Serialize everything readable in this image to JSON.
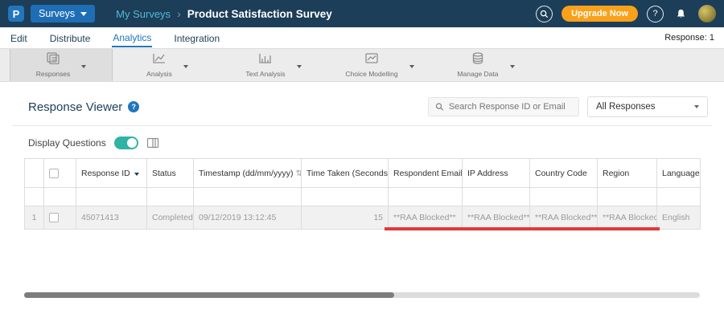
{
  "colors": {
    "navbar_bg": "#1c3e58",
    "brand_blue": "#2176bd",
    "breadcrumb_link": "#56b7d5",
    "upgrade_orange": "#f9a11b",
    "tab_active_blue": "#2176bd",
    "toggle_teal": "#2fb3a6",
    "link_blue": "#337ab7",
    "annotation_red": "#e03a3a"
  },
  "topbar": {
    "logo_letter": "P",
    "product_menu_label": "Surveys",
    "breadcrumb": {
      "parent": "My Surveys",
      "separator": "›",
      "current": "Product Satisfaction Survey"
    },
    "upgrade_label": "Upgrade Now",
    "help_glyph": "?"
  },
  "tabs": {
    "items": [
      {
        "label": "Edit"
      },
      {
        "label": "Distribute"
      },
      {
        "label": "Analytics"
      },
      {
        "label": "Integration"
      }
    ],
    "response_count": "Response: 1"
  },
  "toolbar": {
    "items": [
      {
        "label": "Responses"
      },
      {
        "label": "Analysis"
      },
      {
        "label": "Text Analysis"
      },
      {
        "label": "Choice Modelling"
      },
      {
        "label": "Manage Data"
      }
    ]
  },
  "viewer": {
    "title": "Response Viewer",
    "help_glyph": "?",
    "search_placeholder": "Search Response ID or Email",
    "filter_dropdown_value": "All Responses",
    "display_questions_label": "Display Questions"
  },
  "table": {
    "sort_glyph": "⇅",
    "columns": {
      "response_id": "Response ID",
      "status": "Status",
      "timestamp": "Timestamp (dd/mm/yyyy)",
      "time_taken": "Time Taken (Seconds)",
      "respondent_email": "Respondent Email",
      "ip_address": "IP Address",
      "country_code": "Country Code",
      "region": "Region",
      "language": "Language"
    },
    "rows": [
      {
        "index": "1",
        "response_id": "45071413",
        "status": "Completed",
        "timestamp": "09/12/2019 13:12:45",
        "time_taken": "15",
        "respondent_email": "**RAA Blocked**",
        "ip_address": "**RAA Blocked**",
        "country_code": "**RAA Blocked**",
        "region": "**RAA Blocked**",
        "language": "English"
      }
    ]
  }
}
